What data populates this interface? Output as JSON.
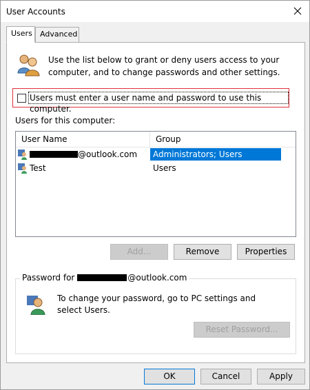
{
  "window": {
    "title": "User Accounts"
  },
  "tabs": [
    {
      "label": "Users"
    },
    {
      "label": "Advanced"
    }
  ],
  "info": {
    "text": "Use the list below to grant or deny users access to your computer, and to change passwords and other settings."
  },
  "checkbox": {
    "label": "Users must enter a user name and password to use this computer.",
    "checked": false
  },
  "users_list": {
    "label": "Users for this computer:",
    "columns": [
      "User Name",
      "Group"
    ],
    "rows": [
      {
        "name": "@outlook.com",
        "group": "Administrators; Users",
        "selected": true
      },
      {
        "name": "Test",
        "group": "Users",
        "selected": false
      }
    ]
  },
  "list_buttons": {
    "add": "Add...",
    "remove": "Remove",
    "properties": "Properties"
  },
  "password_group": {
    "title_prefix": "Password for",
    "title_suffix": "@outlook.com",
    "text": "To change your password, go to PC settings and select Users.",
    "reset_button": "Reset Password..."
  },
  "footer": {
    "ok": "OK",
    "cancel": "Cancel",
    "apply": "Apply"
  },
  "colors": {
    "highlight_border": "#e0303a",
    "selection": "#0078d7"
  }
}
